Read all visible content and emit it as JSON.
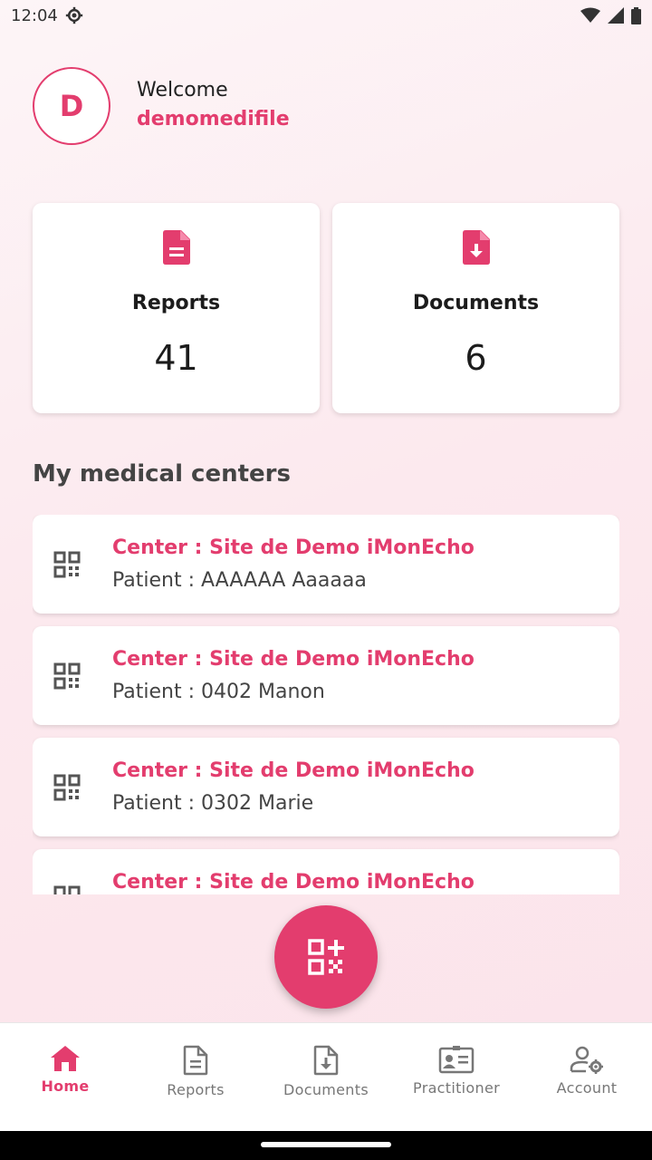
{
  "status_bar": {
    "time": "12:04"
  },
  "welcome": {
    "avatar_letter": "D",
    "label": "Welcome",
    "username": "demomedifile"
  },
  "stats": [
    {
      "title": "Reports",
      "value": "41",
      "icon": "report-icon"
    },
    {
      "title": "Documents",
      "value": "6",
      "icon": "document-download-icon"
    }
  ],
  "section_title": "My medical centers",
  "centers": [
    {
      "title": "Center : Site de Demo iMonEcho",
      "patient": "Patient : AAAAAA Aaaaaa"
    },
    {
      "title": "Center : Site de Demo iMonEcho",
      "patient": "Patient : 0402 Manon"
    },
    {
      "title": "Center : Site de Demo iMonEcho",
      "patient": "Patient : 0302 Marie"
    },
    {
      "title": "Center : Site de Demo iMonEcho",
      "patient": ""
    }
  ],
  "nav": [
    {
      "label": "Home",
      "icon": "home-icon",
      "active": true
    },
    {
      "label": "Reports",
      "icon": "report-icon",
      "active": false
    },
    {
      "label": "Documents",
      "icon": "document-download-icon",
      "active": false
    },
    {
      "label": "Practitioner",
      "icon": "practitioner-card-icon",
      "active": false
    },
    {
      "label": "Account",
      "icon": "account-settings-icon",
      "active": false
    }
  ],
  "colors": {
    "accent": "#e33d6e",
    "inactive": "#777777"
  }
}
